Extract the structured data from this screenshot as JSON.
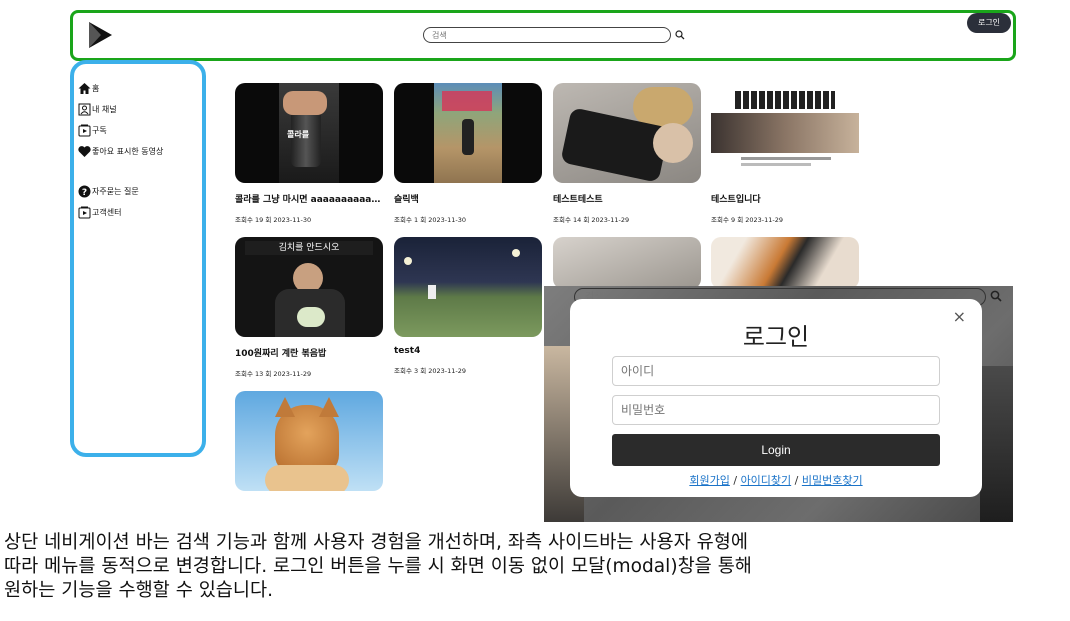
{
  "header": {
    "search_placeholder": "검색",
    "login_label": "로그인"
  },
  "sidebar": {
    "items": [
      {
        "label": "홈",
        "icon": "home-icon"
      },
      {
        "label": "내 채널",
        "icon": "channel-icon"
      },
      {
        "label": "구독",
        "icon": "subscribe-icon"
      },
      {
        "label": "좋아요 표시한 동영상",
        "icon": "heart-icon"
      },
      {
        "label": "자주묻는 질문",
        "icon": "question-icon"
      },
      {
        "label": "고객센터",
        "icon": "support-icon"
      }
    ]
  },
  "videos": [
    {
      "title": "콜라를 그냥 마시면 aaaaaaaaaaaaaaa",
      "meta": "조회수 19 회 2023-11-30",
      "thumb_text": "콜라를"
    },
    {
      "title": "슬릭백",
      "meta": "조회수 1 회 2023-11-30",
      "thumb_text": ""
    },
    {
      "title": "테스트테스트",
      "meta": "조회수 14 회 2023-11-29",
      "thumb_text": ""
    },
    {
      "title": "테스트입니다",
      "meta": "조회수 9 회 2023-11-29",
      "thumb_text": ""
    },
    {
      "title": "100원짜리 계란 볶음밥",
      "meta": "조회수 13 회 2023-11-29",
      "thumb_text": "김치를 안드시오"
    },
    {
      "title": "test4",
      "meta": "조회수 3 회 2023-11-29",
      "thumb_text": ""
    }
  ],
  "modal_shot": {
    "search_placeholder": "검색",
    "title": "로그인",
    "close": "×",
    "id_placeholder": "아이디",
    "pw_placeholder": "비밀번호",
    "login_button": "Login",
    "links": {
      "signup": "회원가입",
      "find_id": "아이디찾기",
      "find_pw": "비밀번호찾기",
      "sep": " / "
    }
  },
  "caption": {
    "line1": "상단 네비게이션 바는 검색 기능과 함께 사용자 경험을 개선하며, 좌측 사이드바는 사용자 유형에",
    "line2": "따라 메뉴를 동적으로 변경합니다. 로그인 버튼을 누를 시 화면 이동 없이 모달(modal)창을 통해",
    "line3": "원하는 기능을 수행할 수 있습니다."
  },
  "colors": {
    "nav_border": "#1aa51a",
    "sidebar_border": "#3cb0ea",
    "login_button": "#2b2f3a",
    "link": "#1a73c8"
  }
}
